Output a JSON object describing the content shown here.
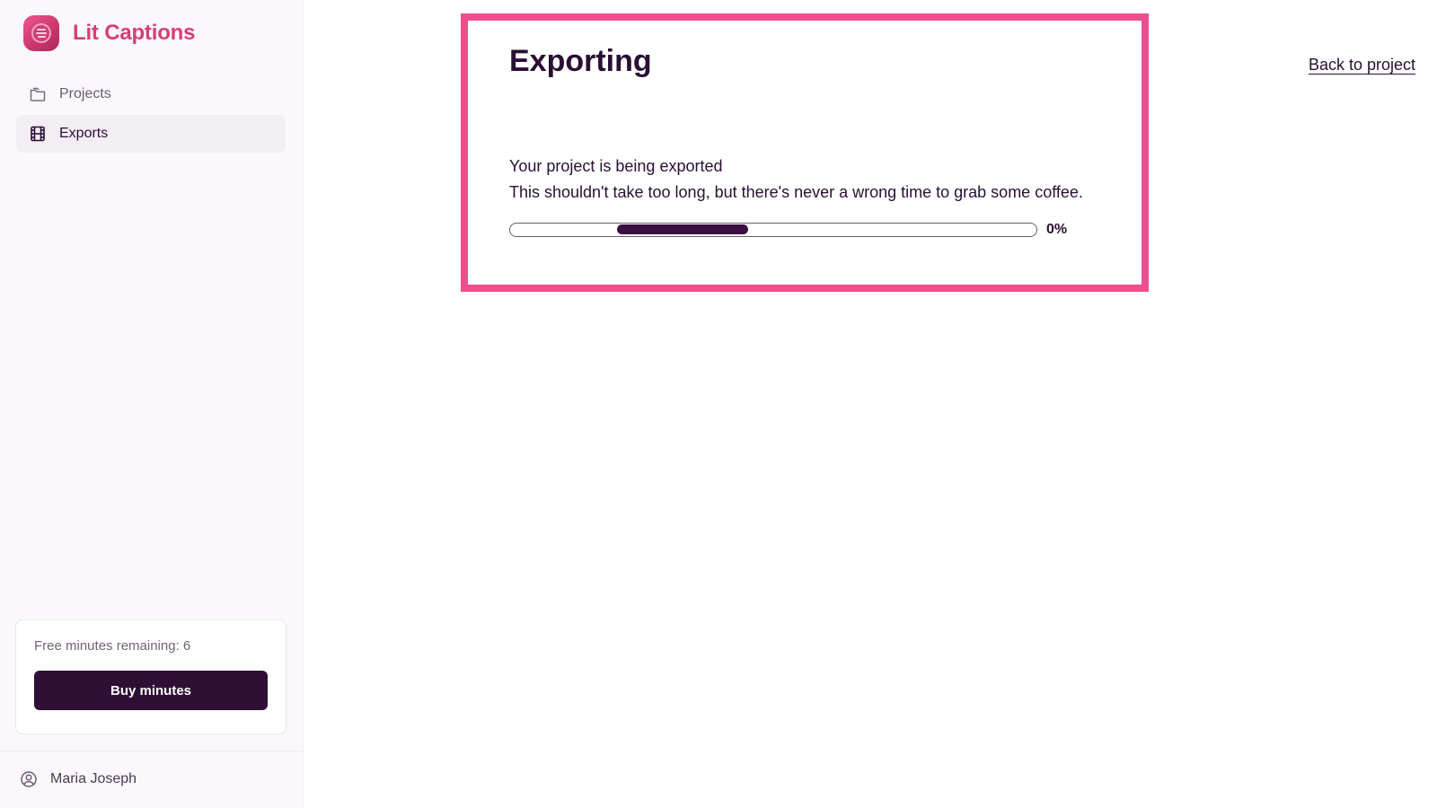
{
  "app": {
    "name": "Lit Captions",
    "brand_color": "#d63f78"
  },
  "sidebar": {
    "items": [
      {
        "label": "Projects",
        "icon": "folder-icon",
        "active": false
      },
      {
        "label": "Exports",
        "icon": "film-icon",
        "active": true
      }
    ],
    "minutes": {
      "text": "Free minutes remaining: 6",
      "buy_label": "Buy minutes"
    },
    "user": {
      "name": "Maria Joseph",
      "icon": "user-circle-icon"
    }
  },
  "main": {
    "back_link": "Back to project",
    "export": {
      "title": "Exporting",
      "line1": "Your project is being exported",
      "line2": "This shouldn't take too long, but there's never a wrong time to grab some coffee.",
      "progress_label": "0%",
      "progress_percent": 0,
      "highlight_color": "#ec4f8e"
    }
  }
}
